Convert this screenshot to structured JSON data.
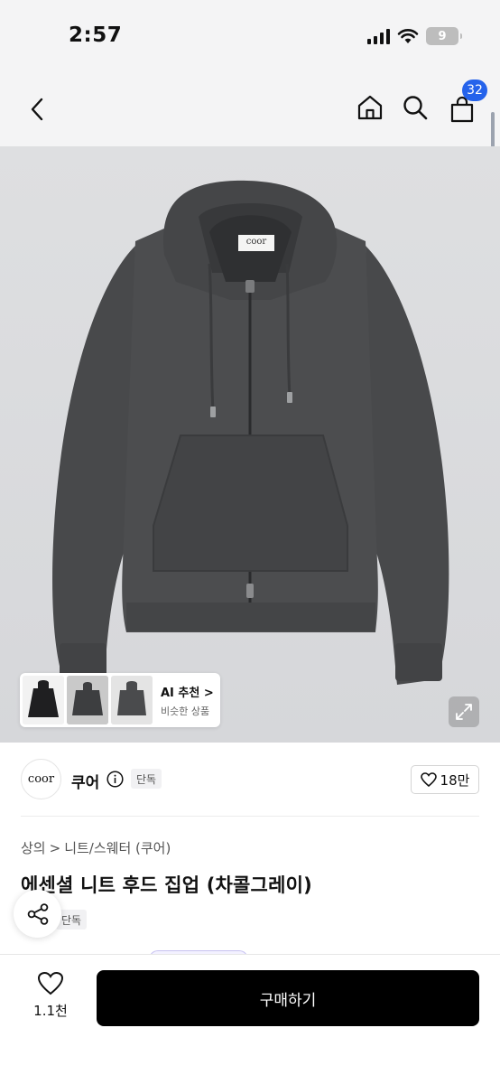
{
  "status": {
    "time": "2:57",
    "battery": "9"
  },
  "nav": {
    "cart_count": "32"
  },
  "ai_panel": {
    "title": "AI 추천",
    "chevron": ">",
    "subtitle": "비슷한 상품"
  },
  "brand": {
    "logo_text": "coor",
    "name": "쿠어",
    "tag": "단독",
    "likes": "18만"
  },
  "breadcrumb": {
    "category": "상의",
    "separator": ">",
    "subcategory": "니트/스웨터 (쿠어)"
  },
  "product": {
    "title": "에센셜 니트 후드 집업 (차콜그레이)",
    "tag": "단독",
    "garment_label": "coor"
  },
  "bottom": {
    "wish_count": "1.1천",
    "buy_label": "구매하기"
  },
  "colors": {
    "badge": "#2563eb",
    "buy_button": "#000000",
    "garment": "#4a4b4d"
  },
  "icons": [
    "back-arrow-icon",
    "home-icon",
    "search-icon",
    "cart-icon",
    "expand-icon",
    "info-icon",
    "heart-icon",
    "share-icon"
  ]
}
